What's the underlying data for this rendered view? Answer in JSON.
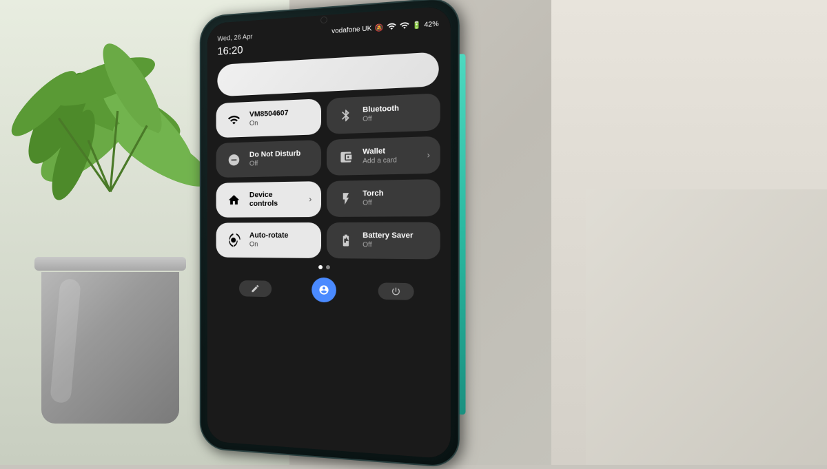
{
  "scene": {
    "bg_color": "#c8c5be"
  },
  "phone": {
    "status_bar": {
      "date": "Wed, 26 Apr",
      "time": "16:20",
      "carrier": "vodafone UK",
      "battery": "42%"
    },
    "top_pill": "",
    "tiles": [
      {
        "id": "wifi",
        "label": "VM8504607",
        "sublabel": "On",
        "icon": "wifi",
        "active": true,
        "has_arrow": false
      },
      {
        "id": "bluetooth",
        "label": "Bluetooth",
        "sublabel": "Off",
        "icon": "bluetooth",
        "active": false,
        "has_arrow": false
      },
      {
        "id": "dnd",
        "label": "Do Not Disturb",
        "sublabel": "Off",
        "icon": "dnd",
        "active": false,
        "has_arrow": false
      },
      {
        "id": "wallet",
        "label": "Wallet",
        "sublabel": "Add a card",
        "icon": "wallet",
        "active": false,
        "has_arrow": true
      },
      {
        "id": "device-controls",
        "label": "Device controls",
        "sublabel": "",
        "icon": "device",
        "active": true,
        "has_arrow": true
      },
      {
        "id": "torch",
        "label": "Torch",
        "sublabel": "Off",
        "icon": "torch",
        "active": false,
        "has_arrow": false
      },
      {
        "id": "auto-rotate",
        "label": "Auto-rotate",
        "sublabel": "On",
        "icon": "rotate",
        "active": true,
        "has_arrow": false
      },
      {
        "id": "battery-saver",
        "label": "Battery Saver",
        "sublabel": "Off",
        "icon": "battery",
        "active": false,
        "has_arrow": false
      }
    ],
    "bottom_nav": {
      "btn1": "✏",
      "btn2": "◉",
      "btn3": "⏻"
    }
  }
}
